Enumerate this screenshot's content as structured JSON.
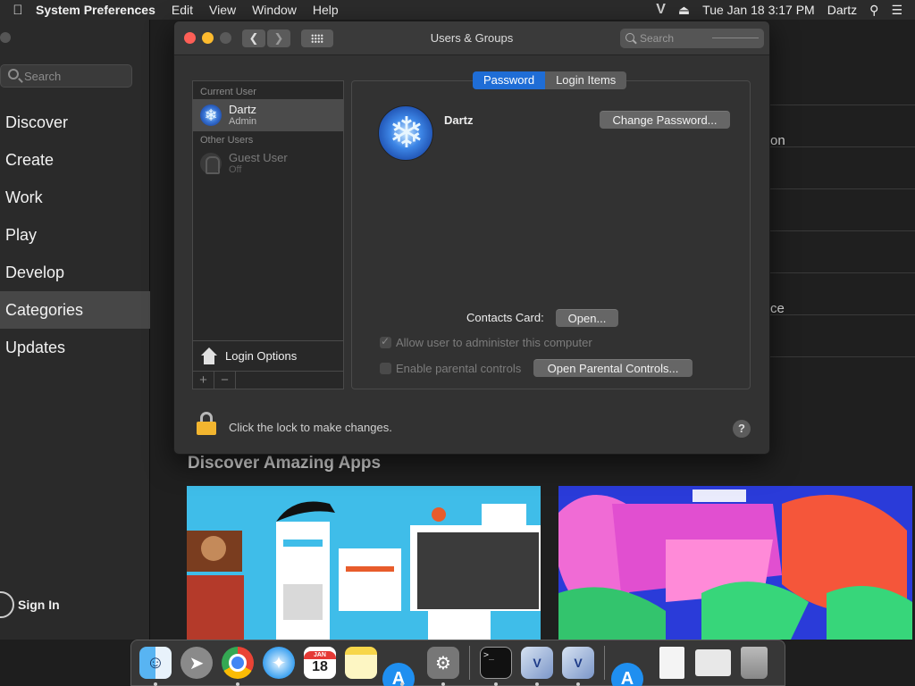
{
  "menubar": {
    "app_name": "System Preferences",
    "menus": [
      "Edit",
      "View",
      "Window",
      "Help"
    ],
    "status_v": "V",
    "datetime": "Tue Jan 18  3:17 PM",
    "user": "Dartz"
  },
  "appstore": {
    "search_placeholder": "Search",
    "nav": [
      "Discover",
      "Create",
      "Work",
      "Play",
      "Develop",
      "Categories",
      "Updates"
    ],
    "active_nav": "Categories",
    "sign_in": "Sign In",
    "discover_title": "Discover Amazing Apps",
    "right_fragments": [
      "on",
      "ce"
    ]
  },
  "window": {
    "title": "Users & Groups",
    "search_placeholder": "Search",
    "users": {
      "current_header": "Current User",
      "current_user": {
        "name": "Dartz",
        "role": "Admin"
      },
      "other_header": "Other Users",
      "guest_user": {
        "name": "Guest User",
        "role": "Off"
      },
      "login_options": "Login Options",
      "add": "+",
      "remove": "−"
    },
    "tabs": [
      "Password",
      "Login Items"
    ],
    "active_tab": "Password",
    "user_name": "Dartz",
    "change_password": "Change Password...",
    "contacts_label": "Contacts Card:",
    "open_button": "Open...",
    "allow_admin": "Allow user to administer this computer",
    "allow_admin_checked": true,
    "parental_controls": "Enable parental controls",
    "parental_checked": false,
    "open_parental": "Open Parental Controls...",
    "lock_text": "Click the lock to make changes.",
    "help": "?"
  },
  "dock": {
    "items": [
      "finder-icon",
      "launchpad-icon",
      "chrome-icon",
      "safari-icon",
      "calendar-icon",
      "notes-icon",
      "app-store-icon",
      "system-preferences-icon",
      "terminal-icon",
      "virtualbox-icon",
      "virtualbox-manager-icon",
      "app-store-download-icon",
      "document-icon",
      "preview-icon",
      "trash-icon"
    ],
    "calendar_month": "JAN",
    "calendar_day": "18",
    "terminal_prompt": ">_"
  },
  "colors": {
    "accent": "#1f6dd6",
    "close": "#fe5f57",
    "minimize": "#febb2e",
    "lock": "#f2b52f"
  }
}
